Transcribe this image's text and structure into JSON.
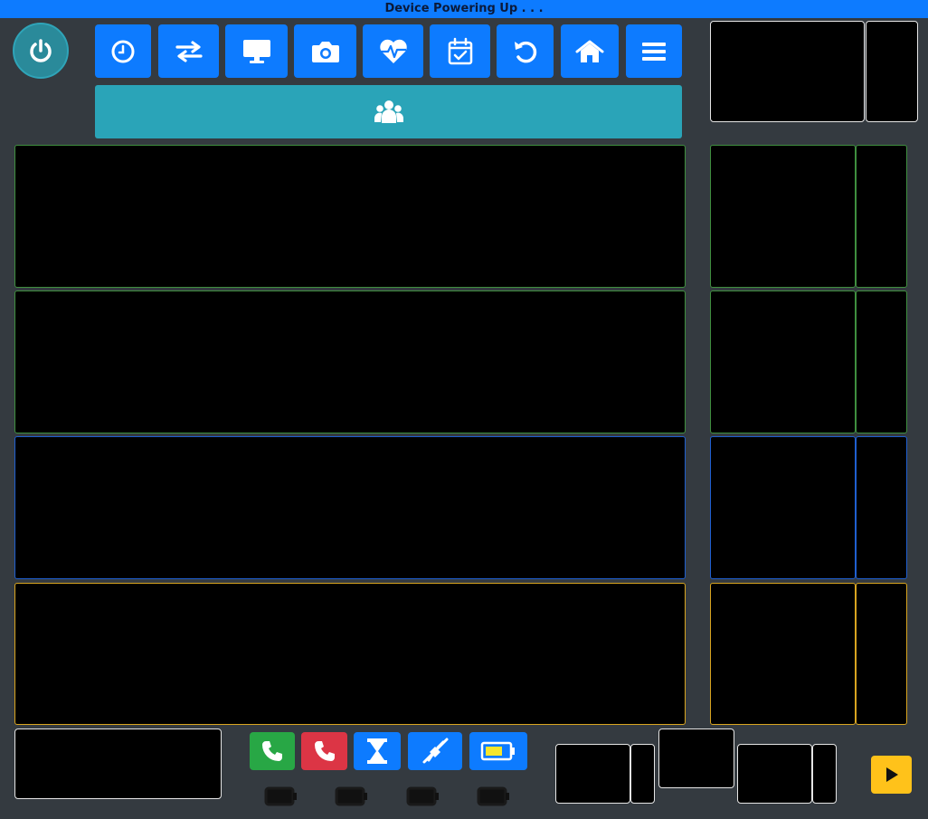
{
  "status": {
    "text": "Device Powering Up . . ."
  },
  "toolbar": {
    "buttons": [
      {
        "name": "history-button",
        "icon": "clock-icon"
      },
      {
        "name": "transfer-button",
        "icon": "swap-arrows-icon"
      },
      {
        "name": "monitor-button",
        "icon": "desktop-icon"
      },
      {
        "name": "camera-button",
        "icon": "camera-icon"
      },
      {
        "name": "vitals-button",
        "icon": "heartbeat-icon"
      },
      {
        "name": "calendar-button",
        "icon": "calendar-check-icon"
      },
      {
        "name": "reset-button",
        "icon": "undo-icon"
      },
      {
        "name": "home-button",
        "icon": "home-icon"
      },
      {
        "name": "menu-button",
        "icon": "hamburger-menu-icon"
      }
    ],
    "group_button_icon": "users-icon"
  },
  "controls": {
    "buttons": [
      {
        "name": "call-answer-button",
        "icon": "phone-icon",
        "color": "#28a745"
      },
      {
        "name": "call-hangup-button",
        "icon": "phone-icon",
        "color": "#dc3545"
      },
      {
        "name": "timer-button",
        "icon": "hourglass-icon",
        "color": "#0d7bff"
      },
      {
        "name": "mute-button",
        "icon": "no-plug-icon",
        "color": "#0d7bff"
      },
      {
        "name": "battery-button",
        "icon": "battery-icon",
        "color": "#0d7bff"
      }
    ],
    "battery_indicators": 4,
    "play_button_icon": "play-icon"
  },
  "colors": {
    "primary": "#0d7bff",
    "teal": "#2aa4b8",
    "panel_green": "#3f8f3f",
    "panel_blue": "#1f5fd0",
    "panel_yellow": "#d9a520",
    "play": "#ffc21a",
    "battery_fill": "#f6e62c"
  }
}
